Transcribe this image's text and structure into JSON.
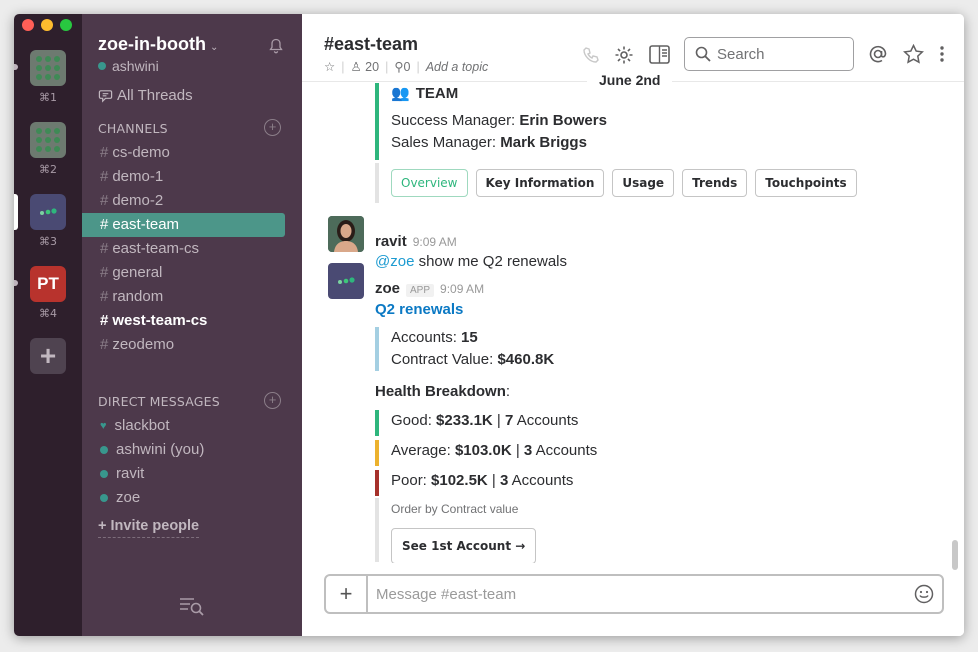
{
  "workspaces": [
    {
      "shortcut": "⌘1",
      "style": "dots"
    },
    {
      "shortcut": "⌘2",
      "style": "dots"
    },
    {
      "shortcut": "⌘3",
      "style": "zoe",
      "active": true
    },
    {
      "shortcut": "⌘4",
      "initials": "PT"
    }
  ],
  "sidebar": {
    "team_name": "zoe-in-booth",
    "user": "ashwini",
    "all_threads": "All Threads",
    "channels_header": "CHANNELS",
    "channels": [
      "cs-demo",
      "demo-1",
      "demo-2",
      "east-team",
      "east-team-cs",
      "general",
      "random",
      "west-team-cs",
      "zeodemo"
    ],
    "dm_header": "DIRECT MESSAGES",
    "dms": [
      "slackbot",
      "ashwini (you)",
      "ravit",
      "zoe"
    ],
    "invite": "+ Invite people"
  },
  "header": {
    "title": "#east-team",
    "members": "20",
    "pins": "0",
    "topic": "Add a topic",
    "search_placeholder": "Search",
    "date_divider": "June 2nd"
  },
  "team_card": {
    "heading": "TEAM",
    "success_label": "Success Manager:",
    "success_name": "Erin Bowers",
    "sales_label": "Sales Manager:",
    "sales_name": "Mark Briggs",
    "buttons": [
      "Overview",
      "Key Information",
      "Usage",
      "Trends",
      "Touchpoints"
    ]
  },
  "messages": [
    {
      "author": "ravit",
      "time": "9:09 AM",
      "mention": "@zoe",
      "text": "show me Q2 renewals"
    },
    {
      "author": "zoe",
      "badge": "APP",
      "time": "9:09 AM",
      "link": "Q2 renewals"
    }
  ],
  "renewals": {
    "accounts_label": "Accounts:",
    "accounts_value": "15",
    "contract_label": "Contract Value:",
    "contract_value": "$460.8K",
    "health_title": "Health Breakdown",
    "health": [
      {
        "label": "Good:",
        "value": "$233.1K",
        "count": "7",
        "unit": "Accounts",
        "color": "#2eb67d"
      },
      {
        "label": "Average:",
        "value": "$103.0K",
        "count": "3",
        "unit": "Accounts",
        "color": "#ecb22e"
      },
      {
        "label": "Poor:",
        "value": "$102.5K",
        "count": "3",
        "unit": "Accounts",
        "color": "#a6312b"
      }
    ],
    "order_note": "Order by Contract value",
    "see_button": "See 1st Account →"
  },
  "composer": {
    "placeholder": "Message #east-team"
  },
  "colors": {
    "sidebar": "#4d394b",
    "rail": "#2e1f2c",
    "active_channel": "#4c9689"
  }
}
